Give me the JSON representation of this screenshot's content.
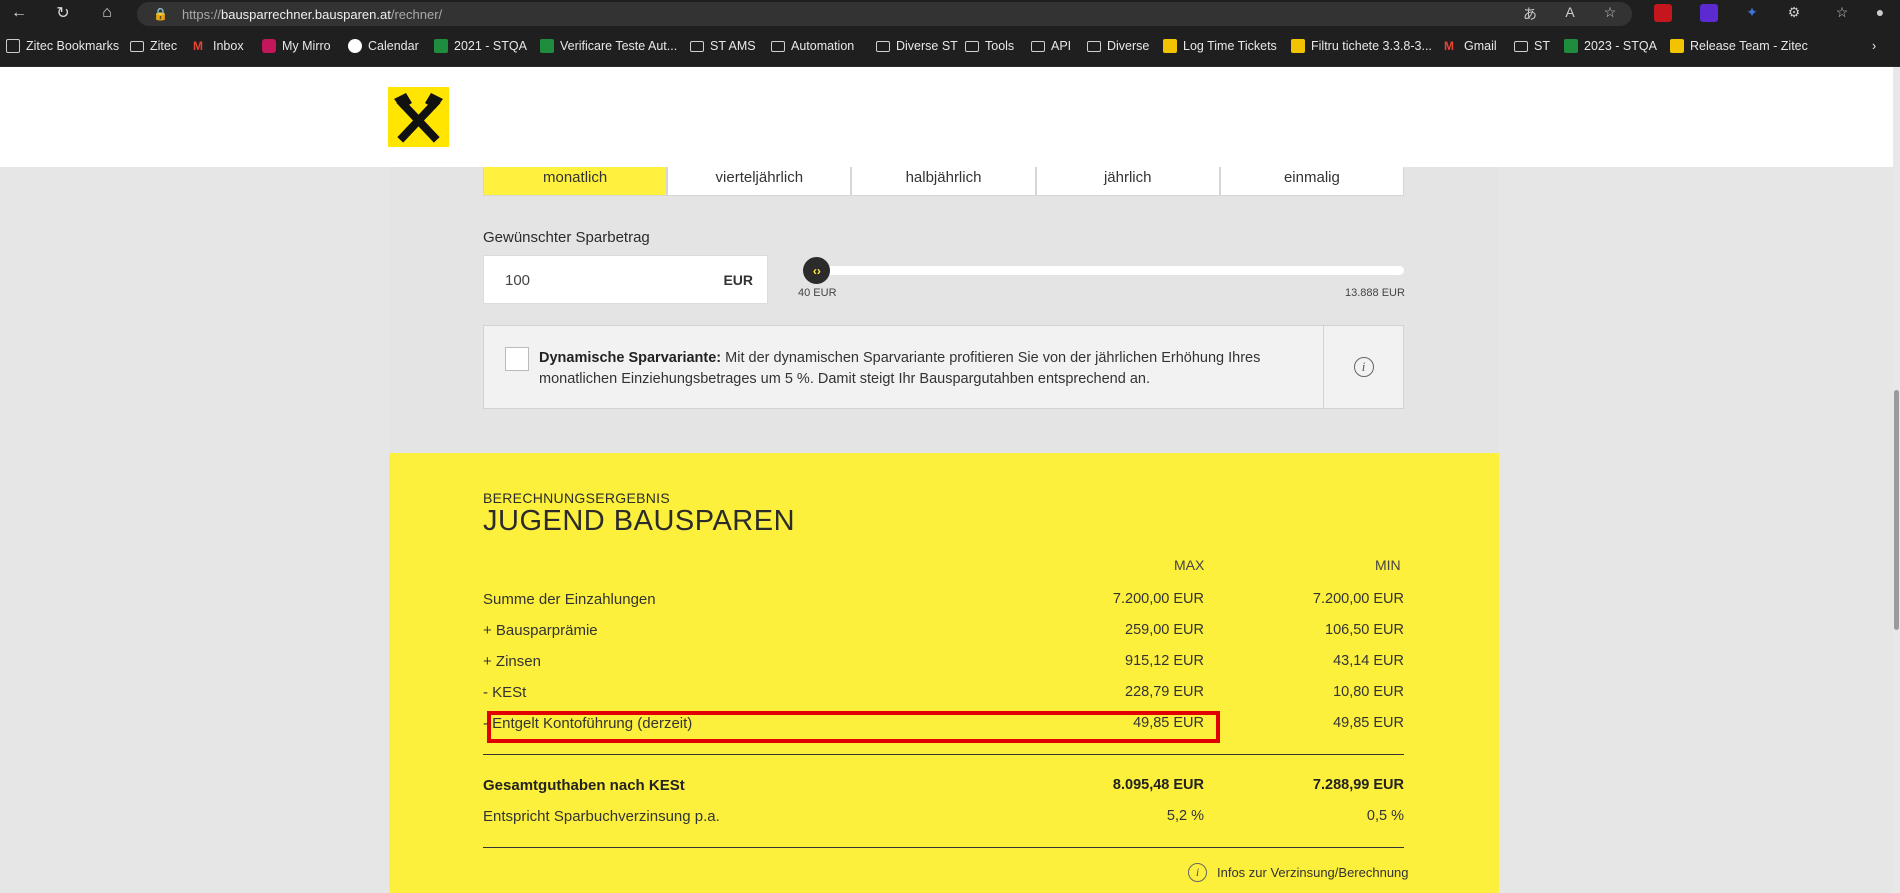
{
  "browser": {
    "url_scheme": "https://",
    "url_host": "bausparrechner.bausparen.at",
    "url_path": "/rechner/",
    "bookmarks": [
      {
        "label": "Zitec Bookmarks",
        "icon": "zitec"
      },
      {
        "label": "Zitec",
        "icon": "folder"
      },
      {
        "label": "Inbox",
        "icon": "gmail"
      },
      {
        "label": "My Mirro",
        "icon": "mirro"
      },
      {
        "label": "Calendar",
        "icon": "google"
      },
      {
        "label": "2021 - STQA",
        "icon": "sheet"
      },
      {
        "label": "Verificare Teste Aut...",
        "icon": "sheet"
      },
      {
        "label": "ST AMS",
        "icon": "folder"
      },
      {
        "label": "Automation",
        "icon": "folder"
      },
      {
        "label": "Diverse ST",
        "icon": "folder"
      },
      {
        "label": "Tools",
        "icon": "folder"
      },
      {
        "label": "API",
        "icon": "folder"
      },
      {
        "label": "Diverse",
        "icon": "folder"
      },
      {
        "label": "Log Time Tickets",
        "icon": "st"
      },
      {
        "label": "Filtru tichete 3.3.8-3...",
        "icon": "st"
      },
      {
        "label": "Gmail",
        "icon": "gmail"
      },
      {
        "label": "ST",
        "icon": "folder"
      },
      {
        "label": "2023 - STQA",
        "icon": "sheet"
      },
      {
        "label": "Release Team - Zitec",
        "icon": "st"
      }
    ]
  },
  "calculator": {
    "frequencies": [
      "monatlich",
      "vierteljährlich",
      "halbjährlich",
      "jährlich",
      "einmalig"
    ],
    "savings_label": "Gewünschter Sparbetrag",
    "amount_value": "100",
    "amount_currency": "EUR",
    "slider_min": "40 EUR",
    "slider_max": "13.888 EUR",
    "slider_position": 0.004,
    "dynamic_title": "Dynamische Sparvariante:",
    "dynamic_text": "Mit der dynamischen Sparvariante profitieren Sie von der jährlichen Erhöhung Ihres monatlichen Einziehungsbetrages um 5 %. Damit steigt Ihr Bauspargutahben entsprechend an.",
    "dynamic_checked": false
  },
  "result": {
    "kicker": "BERECHNUNGSERGEBNIS",
    "title": "JUGEND BAUSPAREN",
    "col_max": "MAX",
    "col_min": "MIN",
    "rows": [
      {
        "label": "Summe der Einzahlungen",
        "max": "7.200,00 EUR",
        "min": "7.200,00 EUR"
      },
      {
        "label": "+ Bausparprämie",
        "max": "259,00 EUR",
        "min": "106,50 EUR"
      },
      {
        "label": "+ Zinsen",
        "max": "915,12 EUR",
        "min": "43,14 EUR"
      },
      {
        "label": "- KESt",
        "max": "228,79 EUR",
        "min": "10,80 EUR"
      },
      {
        "label": "- Entgelt Kontoführung (derzeit)",
        "max": "49,85 EUR",
        "min": "49,85 EUR"
      }
    ],
    "total_label": "Gesamtguthaben nach KESt",
    "total_max": "8.095,48 EUR",
    "total_min": "7.288,99 EUR",
    "rate_label": "Entspricht Sparbuchverzinsung p.a.",
    "rate_max": "5,2 %",
    "rate_min": "0,5 %",
    "info_link": "Infos zur Verzinsung/Berechnung"
  }
}
